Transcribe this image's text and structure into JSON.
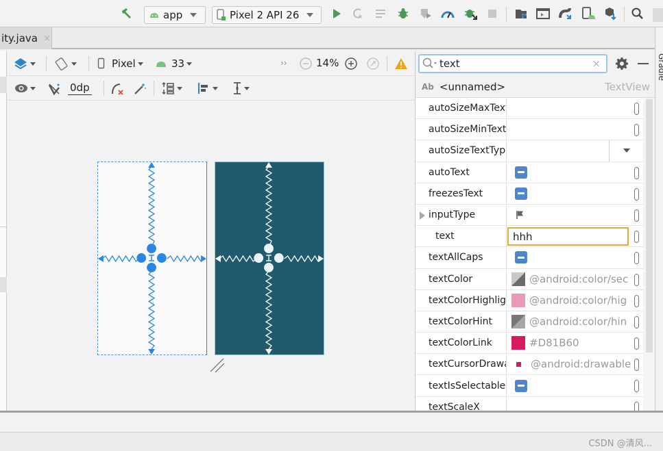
{
  "toolbar": {
    "run_config": "app",
    "device": "Pixel 2 API 26",
    "icons": [
      "build-hammer-icon",
      "run-icon",
      "apply-changes-icon",
      "apply-code-changes-icon",
      "debug-icon",
      "attach-coverage-icon",
      "profile-icon",
      "attach-debugger-icon",
      "stop-icon",
      "project-structure-icon",
      "terminal-icon",
      "gradle-sync-icon",
      "avd-manager-icon",
      "sdk-manager-icon",
      "search-icon"
    ]
  },
  "tabs": [
    {
      "label": "ity.java",
      "close": "×"
    }
  ],
  "design_toolbar": {
    "device_label": "Pixel",
    "api_level": "33",
    "zoom": "14%",
    "more": "››",
    "margin_value": "0dp"
  },
  "attributes": {
    "search_value": "text",
    "search_clear": "×",
    "component_prefix": "Ab",
    "component_name": "<unnamed>",
    "component_class": "TextView",
    "rows": [
      {
        "name": "autoSizeMaxText",
        "type": "empty",
        "value": ""
      },
      {
        "name": "autoSizeMinText",
        "type": "empty",
        "value": ""
      },
      {
        "name": "autoSizeTextType",
        "type": "dropdown",
        "value": ""
      },
      {
        "name": "autoText",
        "type": "bool",
        "value": ""
      },
      {
        "name": "freezesText",
        "type": "bool",
        "value": ""
      },
      {
        "name": "inputType",
        "type": "flag",
        "value": ""
      },
      {
        "name": "text",
        "type": "input",
        "value": "hhh"
      },
      {
        "name": "textAllCaps",
        "type": "bool",
        "value": ""
      },
      {
        "name": "textColor",
        "type": "color-split",
        "value": "@android:color/sec"
      },
      {
        "name": "textColorHighlight",
        "type": "color",
        "color": "#e89ab8",
        "value": "@android:color/hig"
      },
      {
        "name": "textColorHint",
        "type": "color-split2",
        "value": "@android:color/hin"
      },
      {
        "name": "textColorLink",
        "type": "color",
        "color": "#D81B60",
        "value": "#D81B60"
      },
      {
        "name": "textCursorDrawable",
        "type": "drawable",
        "color": "#D81B60",
        "value": "@android:drawable"
      },
      {
        "name": "textIsSelectable",
        "type": "bool",
        "value": ""
      },
      {
        "name": "textScaleX",
        "type": "empty",
        "value": ""
      }
    ]
  },
  "side_panel": {
    "gradle_label": "Gradle"
  },
  "colors": {
    "accent_blue": "#2a86e0",
    "blueprint_dark": "#215a6c",
    "selection_orange": "#e5a93b",
    "bool_blue": "#4e86c9"
  },
  "watermark": "CSDN @清风..."
}
